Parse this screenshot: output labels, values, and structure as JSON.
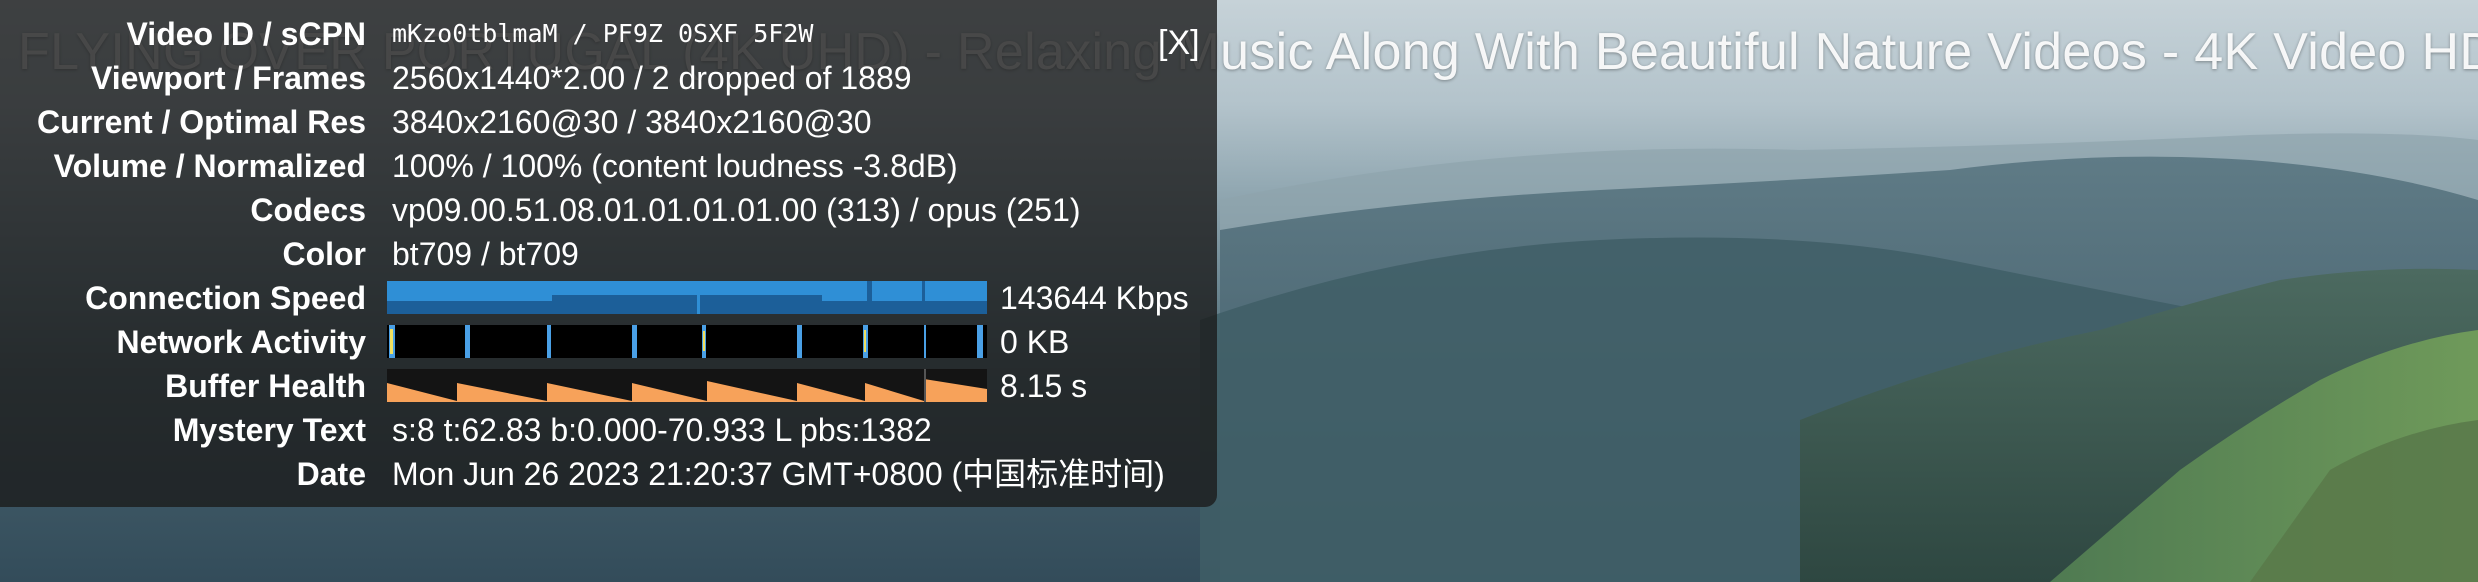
{
  "video": {
    "title": "FLYING OVER PORTUGAL (4K UHD) - Relaxing Music Along With Beautiful Nature Videos - 4K Video HD"
  },
  "stats_panel": {
    "close_label": "[X]",
    "rows": [
      {
        "label": "Video ID / sCPN",
        "value": "mKzo0tblmaM  /  PF9Z 0SXF 5F2W"
      },
      {
        "label": "Viewport / Frames",
        "value": "2560x1440*2.00 / 2 dropped of 1889"
      },
      {
        "label": "Current / Optimal Res",
        "value": "3840x2160@30 / 3840x2160@30"
      },
      {
        "label": "Volume / Normalized",
        "value": "100% / 100% (content loudness -3.8dB)"
      },
      {
        "label": "Codecs",
        "value": "vp09.00.51.08.01.01.01.01.00 (313) / opus (251)"
      },
      {
        "label": "Color",
        "value": "bt709 / bt709"
      },
      {
        "label": "Connection Speed",
        "value": "143644 Kbps"
      },
      {
        "label": "Network Activity",
        "value": "0 KB"
      },
      {
        "label": "Buffer Health",
        "value": "8.15 s"
      },
      {
        "label": "Mystery Text",
        "value": "s:8 t:62.83 b:0.000-70.933 L pbs:1382"
      },
      {
        "label": "Date",
        "value": "Mon Jun 26 2023 21:20:37 GMT+0800 (中国标准时间)"
      }
    ]
  },
  "colors": {
    "connection_bar": "#2f8fd6",
    "connection_bar_dark": "#1c5f99",
    "network_bar_bg": "#000000",
    "network_spike": "#4aa0e6",
    "buffer_fill": "#f7a25a",
    "buffer_bg": "#141414"
  }
}
